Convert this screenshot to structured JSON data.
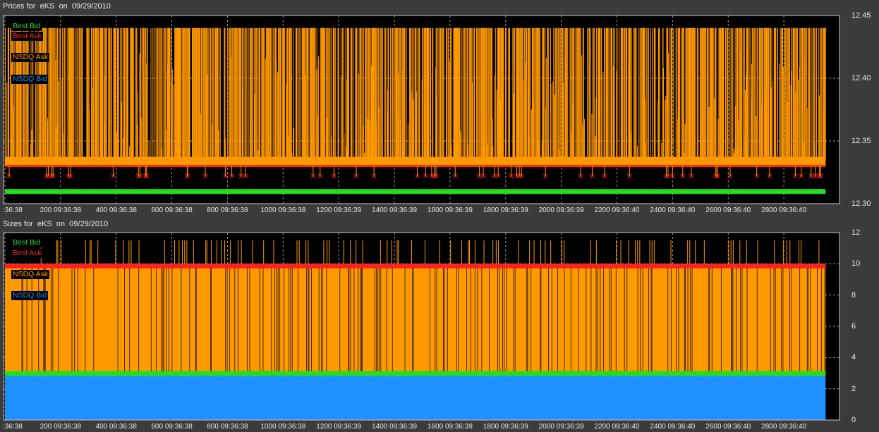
{
  "chart_data": [
    {
      "type": "line",
      "title": "Prices for  eKS  on  09/29/2010",
      "legend": [
        {
          "name": "Best Bid",
          "color": "#22dd22"
        },
        {
          "name": "Best Ask",
          "color": "#ff2020"
        },
        {
          "name": "NSDQ Ask",
          "color": "#ff9900"
        },
        {
          "name": "NSDQ Bid",
          "color": "#1e90ff"
        }
      ],
      "legend_placement": "top-left",
      "xlim": [
        -5,
        3000
      ],
      "ylim": [
        12.3,
        12.45
      ],
      "yticks": [
        "12.30",
        "12.35",
        "12.40",
        "12.45"
      ],
      "x_tick_labels": [
        ":36:38",
        "200 09:36:38",
        "400 09:36:38",
        "600 09:36:38",
        "800 09:36:38",
        "1000 09:36:38",
        "1200 09:36:39",
        "1400 09:36:39",
        "1600 09:36:39",
        "1800 09:36:39",
        "2000 09:36:39",
        "2200 09:36:40",
        "2400 09:36:40",
        "2600 09:36:40",
        "2800 09:36:40"
      ],
      "grid": true,
      "series": [
        {
          "name": "Best Bid",
          "values": [
            12.31,
            12.31
          ]
        },
        {
          "name": "Best Ask",
          "values": [
            12.33,
            12.33
          ]
        },
        {
          "name": "NSDQ Ask",
          "values": [
            12.335,
            12.44
          ]
        }
      ]
    },
    {
      "type": "area",
      "title": "Sizes for  eKS  on  09/29/2010",
      "legend": [
        {
          "name": "Best Bid",
          "color": "#22dd22"
        },
        {
          "name": "Best Ask",
          "color": "#ff2020"
        },
        {
          "name": "NSDQ Ask",
          "color": "#ff9900"
        },
        {
          "name": "NSDQ Bid",
          "color": "#1e90ff"
        }
      ],
      "legend_placement": "top-left",
      "xlim": [
        -5,
        3000
      ],
      "ylim": [
        0,
        12
      ],
      "yticks": [
        "0",
        "2",
        "4",
        "6",
        "8",
        "10",
        "12"
      ],
      "x_tick_labels": [
        ":36:38",
        "200 09:36:38",
        "400 09:36:38",
        "600 09:36:38",
        "800 09:36:38",
        "1000 09:36:38",
        "1200 09:36:39",
        "1400 09:36:39",
        "1600 09:36:39",
        "1800 09:36:39",
        "2000 09:36:39",
        "2200 09:36:40",
        "2400 09:36:40",
        "2600 09:36:40",
        "2800 09:36:40"
      ],
      "grid": true,
      "series": [
        {
          "name": "NSDQ Bid",
          "values": [
            3,
            3
          ]
        },
        {
          "name": "Best Bid",
          "values": [
            3,
            3
          ]
        },
        {
          "name": "NSDQ Ask",
          "values": [
            10,
            10
          ]
        },
        {
          "name": "Best Ask",
          "values": [
            9.8,
            9.8
          ]
        }
      ]
    }
  ]
}
